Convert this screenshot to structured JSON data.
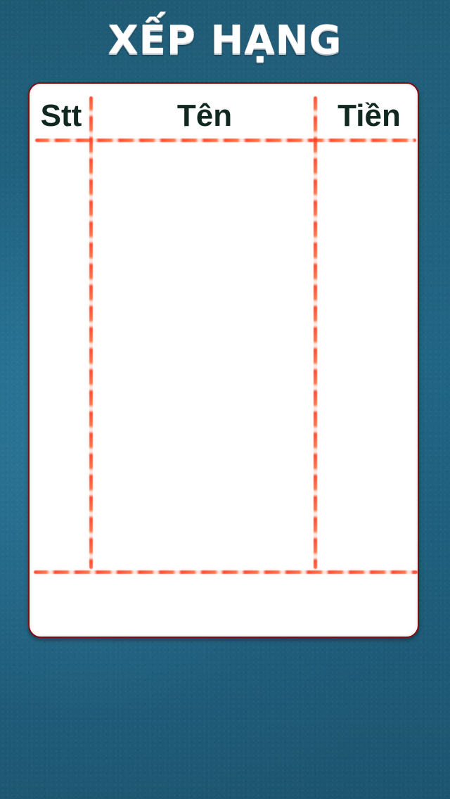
{
  "title": "XẾP HẠNG",
  "table": {
    "columns": [
      "Stt",
      "Tên",
      "Tiền"
    ],
    "rows": []
  },
  "colors": {
    "background": "#1f6585",
    "panel": "#ffffff",
    "panel_border": "#7d0e14",
    "header_text": "#10281f",
    "divider": "#ff3b1f"
  }
}
